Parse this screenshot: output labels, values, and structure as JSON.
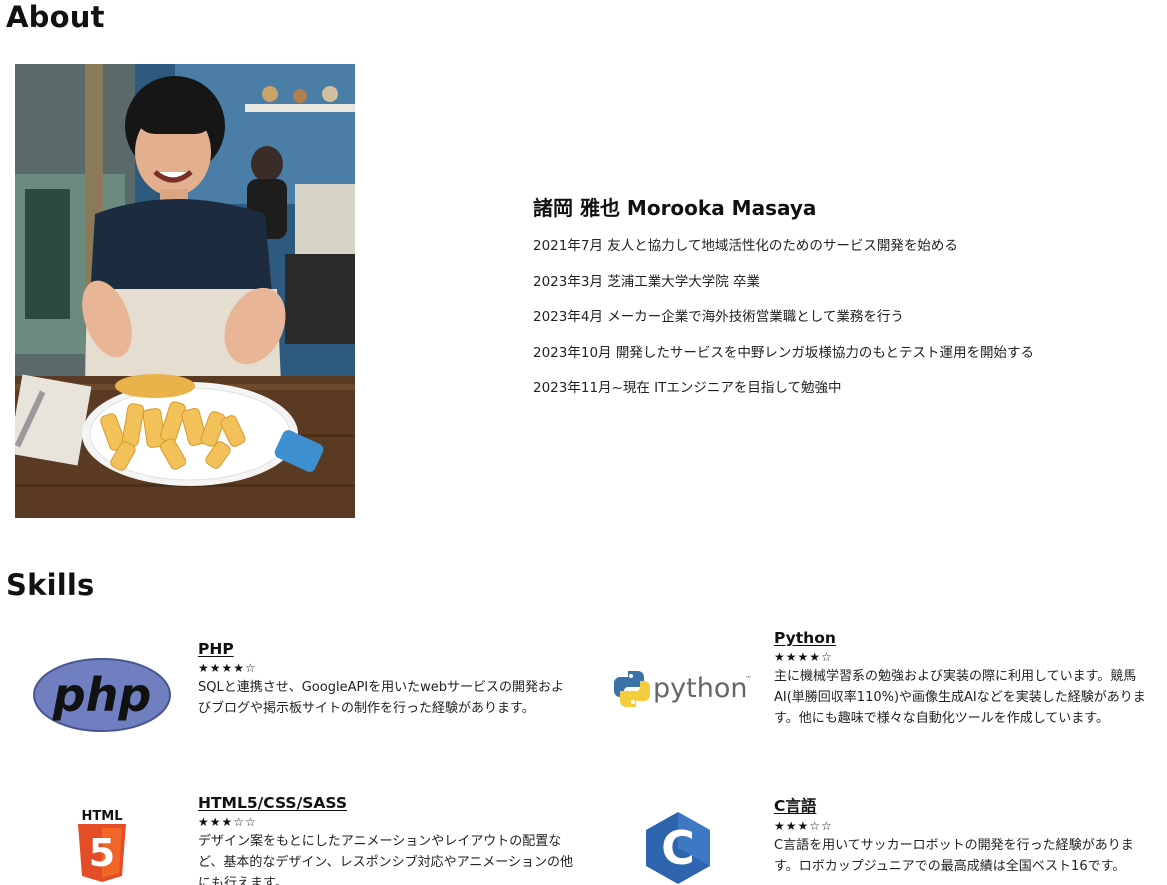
{
  "about": {
    "title": "About",
    "name": "諸岡 雅也 Morooka Masaya",
    "history": [
      "2021年7月 友人と協力して地域活性化のためのサービス開発を始める",
      "2023年3月 芝浦工業大学大学院 卒業",
      "2023年4月 メーカー企業で海外技術営業職として業務を行う",
      "2023年10月 開発したサービスを中野レンガ坂様協力のもとテスト運用を開始する",
      "2023年11月~現在 ITエンジニアを目指して勉強中"
    ]
  },
  "skills": {
    "title": "Skills",
    "items": [
      {
        "name": "PHP",
        "rating": "★★★★☆",
        "logo_icon": "php-logo-icon",
        "logo_text": "php",
        "description": "SQLと連携させ、GoogleAPIを用いたwebサービスの開発およびブログや掲示板サイトの制作を行った経験があります。"
      },
      {
        "name": "Python",
        "rating": "★★★★☆",
        "logo_icon": "python-logo-icon",
        "logo_text": "python",
        "logo_tm": "™",
        "description": "主に機械学習系の勉強および実装の際に利用しています。競馬AI(単勝回収率110%)や画像生成AIなどを実装した経験があります。他にも趣味で様々な自動化ツールを作成しています。"
      },
      {
        "name": "HTML5/CSS/SASS",
        "rating": "★★★☆☆",
        "logo_icon": "html5-logo-icon",
        "logo_text": "HTML",
        "logo_number": "5",
        "description": "デザイン案をもとにしたアニメーションやレイアウトの配置など、基本的なデザイン、レスポンシブ対応やアニメーションの他にも行えます。"
      },
      {
        "name": "C言語",
        "rating": "★★★☆☆",
        "logo_icon": "c-language-logo-icon",
        "logo_text": "C",
        "description": "C言語を用いてサッカーロボットの開発を行った経験があります。ロボカップジュニアでの最高成績は全国ベスト16です。"
      }
    ]
  },
  "colors": {
    "php_purple": "#6f7fc0",
    "python_blue": "#3b73a8",
    "python_yellow": "#f5cd3c",
    "html_orange": "#e44d26",
    "c_blue": "#2e64ad"
  }
}
